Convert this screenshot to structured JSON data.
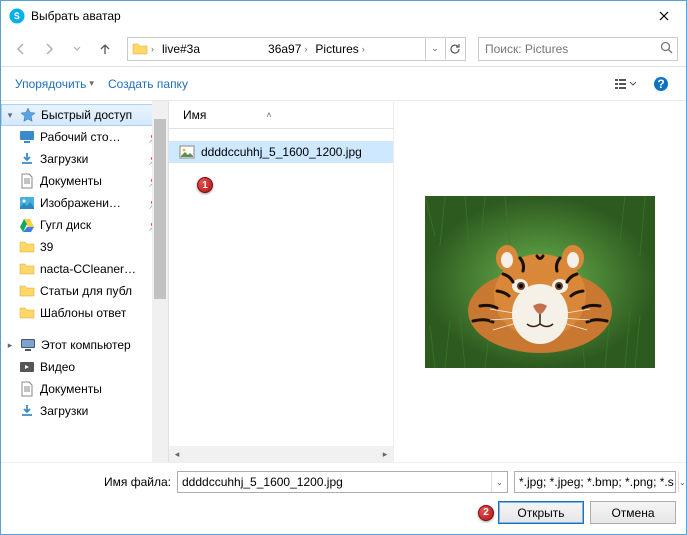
{
  "window": {
    "title": "Выбрать аватар"
  },
  "breadcrumb": {
    "segments": [
      "live#3a",
      "36a97",
      "Pictures"
    ]
  },
  "search": {
    "placeholder": "Поиск: Pictures"
  },
  "toolbar": {
    "organize": "Упорядочить",
    "newfolder": "Создать папку"
  },
  "sidebar": {
    "quick": "Быстрый доступ",
    "items": [
      {
        "label": "Рабочий сто…",
        "icon": "desktop",
        "pin": true
      },
      {
        "label": "Загрузки",
        "icon": "downloads",
        "pin": true
      },
      {
        "label": "Документы",
        "icon": "documents",
        "pin": true
      },
      {
        "label": "Изображени…",
        "icon": "pictures",
        "pin": true
      },
      {
        "label": "Гугл диск",
        "icon": "gdrive",
        "pin": true
      },
      {
        "label": "39",
        "icon": "folder",
        "pin": false
      },
      {
        "label": "nacta-CCleaner…",
        "icon": "folder",
        "pin": false
      },
      {
        "label": "Статьи для публ",
        "icon": "folder",
        "pin": false
      },
      {
        "label": "Шаблоны ответ",
        "icon": "folder",
        "pin": false
      }
    ],
    "pc": "Этот компьютер",
    "pcitems": [
      {
        "label": "Видео",
        "icon": "video"
      },
      {
        "label": "Документы",
        "icon": "documents"
      },
      {
        "label": "Загрузки",
        "icon": "downloads"
      }
    ]
  },
  "filelist": {
    "col_name": "Имя",
    "files": [
      {
        "name": "ddddccuhhj_5_1600_1200.jpg"
      }
    ]
  },
  "annotations": {
    "b1": "1",
    "b2": "2"
  },
  "footer": {
    "filename_label": "Имя файла:",
    "filename_value": "ddddccuhhj_5_1600_1200.jpg",
    "filter_value": "*.jpg; *.jpeg; *.bmp; *.png; *.sky",
    "open": "Открыть",
    "cancel": "Отмена"
  }
}
